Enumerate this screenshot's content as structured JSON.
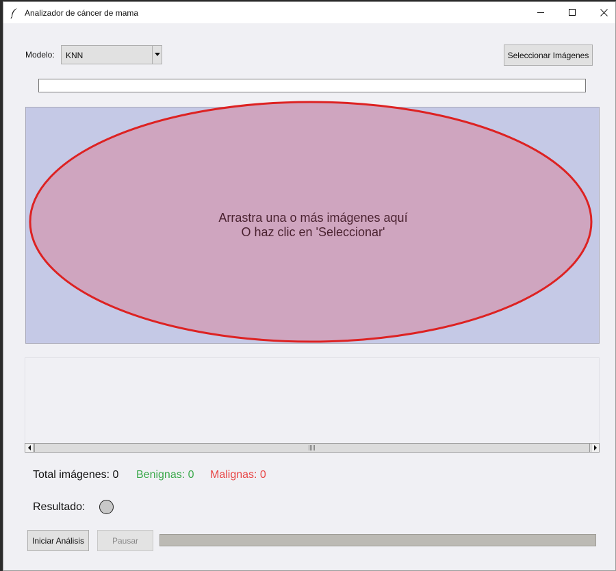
{
  "window": {
    "title": "Analizador de cáncer de mama"
  },
  "model": {
    "label": "Modelo:",
    "selected": "KNN"
  },
  "select_button": "Seleccionar Imágenes",
  "path_value": "",
  "drop_zone": {
    "line1": "Arrastra una o más imágenes aquí",
    "line2": "O haz clic en 'Seleccionar'"
  },
  "stats": {
    "total": "Total imágenes: 0",
    "benign": "Benignas: 0",
    "malignant": "Malignas: 0"
  },
  "result": {
    "label": "Resultado:"
  },
  "actions": {
    "start": "Iniciar Análisis",
    "pause": "Pausar"
  },
  "progress": {
    "fraction": 0
  },
  "colors": {
    "drop_zone_bg": "#c5c9e6",
    "ellipse_fill": "#cfa5bf",
    "ellipse_stroke": "#dd2222",
    "benign": "#3aa84a",
    "malignant": "#e84545"
  },
  "icons": {
    "app": "feather-icon",
    "minimize": "minimize-icon",
    "maximize": "maximize-icon",
    "close": "close-icon"
  }
}
